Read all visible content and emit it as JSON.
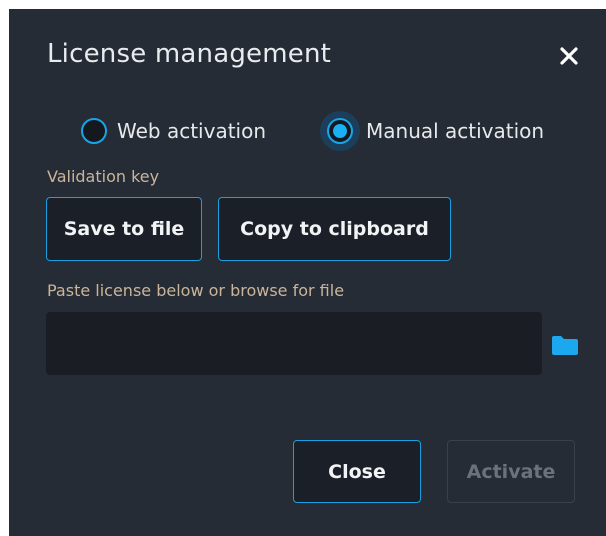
{
  "dialog": {
    "title": "License management",
    "close_icon": "close-icon"
  },
  "activation_mode": {
    "options": [
      {
        "label": "Web activation",
        "selected": false
      },
      {
        "label": "Manual activation",
        "selected": true
      }
    ]
  },
  "validation_key": {
    "label": "Validation key",
    "save_label": "Save to file",
    "copy_label": "Copy to clipboard"
  },
  "license": {
    "label": "Paste license below or browse for file",
    "value": "",
    "browse_icon": "folder-icon"
  },
  "footer": {
    "close_label": "Close",
    "activate_label": "Activate",
    "activate_enabled": false
  },
  "colors": {
    "background": "#262c35",
    "accent": "#1aa3e8",
    "label_tan": "#c9b59b",
    "disabled_text": "#6a727d"
  }
}
